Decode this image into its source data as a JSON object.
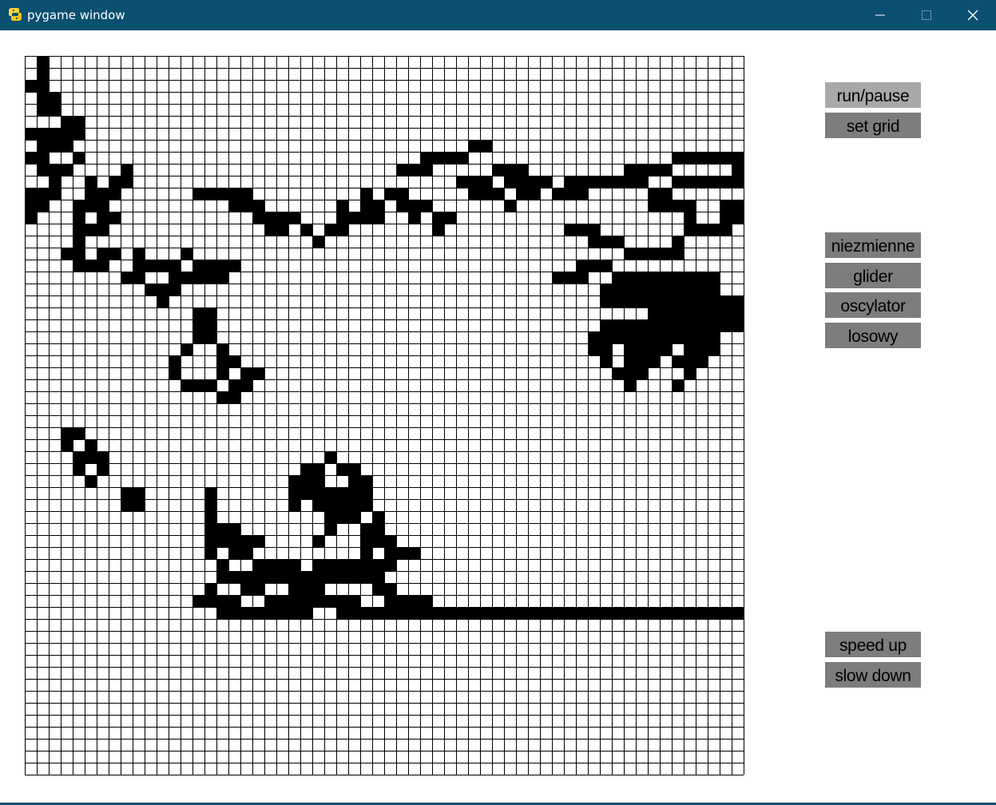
{
  "window": {
    "title": "pygame window",
    "app_icon": "python-snake-icon",
    "controls": [
      "minimize-icon",
      "maximize-icon",
      "close-icon"
    ],
    "title_bar_color": "#0b4f71"
  },
  "controls": {
    "run_pause": "run/pause",
    "set_grid": "set grid",
    "niezmienne": "niezmienne",
    "glider": "glider",
    "oscylator": "oscylator",
    "losowy": "losowy",
    "speed_up": "speed up",
    "slow_down": "slow down"
  },
  "grid": {
    "columns": 60,
    "rows": 60,
    "alive_color": "#000000",
    "dead_color": "#ffffff",
    "line_color": "#000000",
    "alive": [
      [
        1,
        0
      ],
      [
        1,
        1
      ],
      [
        1,
        2
      ],
      [
        0,
        2
      ],
      [
        1,
        3
      ],
      [
        1,
        4
      ],
      [
        2,
        3
      ],
      [
        2,
        4
      ],
      [
        4,
        5
      ],
      [
        3,
        5
      ],
      [
        3,
        6
      ],
      [
        3,
        7
      ],
      [
        2,
        6
      ],
      [
        2,
        7
      ],
      [
        0,
        6
      ],
      [
        1,
        6
      ],
      [
        4,
        6
      ],
      [
        0,
        8
      ],
      [
        4,
        8
      ],
      [
        1,
        9
      ],
      [
        2,
        9
      ],
      [
        3,
        9
      ],
      [
        1,
        7
      ],
      [
        1,
        8
      ],
      [
        0,
        11
      ],
      [
        0,
        12
      ],
      [
        1,
        11
      ],
      [
        1,
        12
      ],
      [
        2,
        10
      ],
      [
        2,
        11
      ],
      [
        0,
        13
      ],
      [
        4,
        12
      ],
      [
        5,
        12
      ],
      [
        6,
        12
      ],
      [
        6,
        13
      ],
      [
        7,
        13
      ],
      [
        6,
        14
      ],
      [
        5,
        11
      ],
      [
        6,
        11
      ],
      [
        7,
        10
      ],
      [
        8,
        9
      ],
      [
        8,
        10
      ],
      [
        7,
        11
      ],
      [
        5,
        10
      ],
      [
        5,
        14
      ],
      [
        4,
        13
      ],
      [
        4,
        14
      ],
      [
        4,
        15
      ],
      [
        3,
        16
      ],
      [
        4,
        16
      ],
      [
        4,
        17
      ],
      [
        5,
        17
      ],
      [
        6,
        17
      ],
      [
        6,
        16
      ],
      [
        7,
        16
      ],
      [
        9,
        16
      ],
      [
        9,
        17
      ],
      [
        10,
        17
      ],
      [
        11,
        17
      ],
      [
        12,
        17
      ],
      [
        9,
        18
      ],
      [
        8,
        18
      ],
      [
        10,
        19
      ],
      [
        11,
        19
      ],
      [
        11,
        20
      ],
      [
        12,
        19
      ],
      [
        12,
        18
      ],
      [
        14,
        17
      ],
      [
        15,
        17
      ],
      [
        16,
        17
      ],
      [
        16,
        18
      ],
      [
        15,
        18
      ],
      [
        14,
        18
      ],
      [
        13,
        18
      ],
      [
        13,
        16
      ],
      [
        17,
        17
      ],
      [
        20,
        14
      ],
      [
        21,
        14
      ],
      [
        21,
        13
      ],
      [
        20,
        13
      ],
      [
        19,
        13
      ],
      [
        19,
        12
      ],
      [
        18,
        12
      ],
      [
        17,
        12
      ],
      [
        17,
        11
      ],
      [
        16,
        11
      ],
      [
        15,
        11
      ],
      [
        14,
        11
      ],
      [
        18,
        11
      ],
      [
        22,
        13
      ],
      [
        23,
        14
      ],
      [
        24,
        15
      ],
      [
        25,
        14
      ],
      [
        26,
        14
      ],
      [
        26,
        13
      ],
      [
        26,
        12
      ],
      [
        27,
        13
      ],
      [
        28,
        12
      ],
      [
        29,
        12
      ],
      [
        28,
        13
      ],
      [
        29,
        13
      ],
      [
        28,
        11
      ],
      [
        30,
        11
      ],
      [
        31,
        11
      ],
      [
        31,
        12
      ],
      [
        32,
        12
      ],
      [
        32,
        13
      ],
      [
        33,
        12
      ],
      [
        34,
        13
      ],
      [
        34,
        14
      ],
      [
        35,
        13
      ],
      [
        31,
        9
      ],
      [
        32,
        9
      ],
      [
        33,
        8
      ],
      [
        33,
        9
      ],
      [
        34,
        8
      ],
      [
        35,
        8
      ],
      [
        36,
        8
      ],
      [
        37,
        7
      ],
      [
        38,
        7
      ],
      [
        36,
        10
      ],
      [
        37,
        10
      ],
      [
        38,
        10
      ],
      [
        37,
        11
      ],
      [
        38,
        11
      ],
      [
        39,
        11
      ],
      [
        40,
        12
      ],
      [
        41,
        11
      ],
      [
        42,
        11
      ],
      [
        41,
        10
      ],
      [
        40,
        10
      ],
      [
        39,
        9
      ],
      [
        40,
        9
      ],
      [
        41,
        9
      ],
      [
        42,
        10
      ],
      [
        43,
        10
      ],
      [
        44,
        11
      ],
      [
        45,
        11
      ],
      [
        46,
        11
      ],
      [
        47,
        10
      ],
      [
        46,
        10
      ],
      [
        45,
        10
      ],
      [
        48,
        10
      ],
      [
        49,
        10
      ],
      [
        50,
        10
      ],
      [
        51,
        10
      ],
      [
        50,
        9
      ],
      [
        51,
        9
      ],
      [
        52,
        9
      ],
      [
        53,
        9
      ],
      [
        54,
        8
      ],
      [
        55,
        8
      ],
      [
        56,
        8
      ],
      [
        57,
        8
      ],
      [
        58,
        8
      ],
      [
        59,
        8
      ],
      [
        59,
        9
      ],
      [
        59,
        10
      ],
      [
        58,
        10
      ],
      [
        57,
        10
      ],
      [
        56,
        10
      ],
      [
        55,
        10
      ],
      [
        54,
        10
      ],
      [
        53,
        11
      ],
      [
        52,
        11
      ],
      [
        52,
        12
      ],
      [
        53,
        12
      ],
      [
        54,
        12
      ],
      [
        55,
        12
      ],
      [
        55,
        13
      ],
      [
        55,
        14
      ],
      [
        56,
        14
      ],
      [
        57,
        14
      ],
      [
        58,
        14
      ],
      [
        58,
        13
      ],
      [
        59,
        13
      ],
      [
        59,
        12
      ],
      [
        58,
        12
      ],
      [
        45,
        14
      ],
      [
        46,
        14
      ],
      [
        47,
        14
      ],
      [
        47,
        15
      ],
      [
        48,
        15
      ],
      [
        49,
        15
      ],
      [
        50,
        16
      ],
      [
        51,
        16
      ],
      [
        52,
        16
      ],
      [
        53,
        16
      ],
      [
        54,
        15
      ],
      [
        54,
        16
      ],
      [
        44,
        18
      ],
      [
        45,
        18
      ],
      [
        46,
        18
      ],
      [
        46,
        17
      ],
      [
        47,
        17
      ],
      [
        48,
        17
      ],
      [
        49,
        18
      ],
      [
        50,
        18
      ],
      [
        51,
        18
      ],
      [
        52,
        19
      ],
      [
        53,
        19
      ],
      [
        54,
        19
      ],
      [
        55,
        19
      ],
      [
        56,
        19
      ],
      [
        57,
        19
      ],
      [
        57,
        18
      ],
      [
        56,
        18
      ],
      [
        55,
        18
      ],
      [
        54,
        18
      ],
      [
        53,
        18
      ],
      [
        52,
        18
      ],
      [
        51,
        19
      ],
      [
        50,
        19
      ],
      [
        49,
        19
      ],
      [
        48,
        19
      ],
      [
        48,
        20
      ],
      [
        49,
        20
      ],
      [
        50,
        20
      ],
      [
        51,
        20
      ],
      [
        52,
        20
      ],
      [
        53,
        20
      ],
      [
        54,
        21
      ],
      [
        55,
        21
      ],
      [
        56,
        21
      ],
      [
        57,
        21
      ],
      [
        58,
        21
      ],
      [
        59,
        21
      ],
      [
        59,
        20
      ],
      [
        58,
        20
      ],
      [
        57,
        20
      ],
      [
        56,
        20
      ],
      [
        55,
        20
      ],
      [
        54,
        20
      ],
      [
        53,
        21
      ],
      [
        52,
        21
      ],
      [
        51,
        22
      ],
      [
        52,
        22
      ],
      [
        53,
        22
      ],
      [
        54,
        22
      ],
      [
        55,
        22
      ],
      [
        56,
        22
      ],
      [
        57,
        22
      ],
      [
        58,
        22
      ],
      [
        59,
        22
      ],
      [
        50,
        22
      ],
      [
        49,
        22
      ],
      [
        48,
        22
      ],
      [
        47,
        23
      ],
      [
        48,
        23
      ],
      [
        49,
        23
      ],
      [
        50,
        23
      ],
      [
        51,
        23
      ],
      [
        52,
        23
      ],
      [
        53,
        23
      ],
      [
        54,
        23
      ],
      [
        55,
        23
      ],
      [
        56,
        23
      ],
      [
        57,
        23
      ],
      [
        47,
        24
      ],
      [
        48,
        24
      ],
      [
        50,
        24
      ],
      [
        51,
        24
      ],
      [
        52,
        24
      ],
      [
        53,
        24
      ],
      [
        55,
        24
      ],
      [
        56,
        24
      ],
      [
        57,
        24
      ],
      [
        48,
        25
      ],
      [
        50,
        25
      ],
      [
        51,
        25
      ],
      [
        52,
        25
      ],
      [
        54,
        25
      ],
      [
        55,
        25
      ],
      [
        56,
        25
      ],
      [
        49,
        26
      ],
      [
        50,
        26
      ],
      [
        51,
        26
      ],
      [
        55,
        26
      ],
      [
        50,
        27
      ],
      [
        54,
        27
      ],
      [
        14,
        21
      ],
      [
        15,
        21
      ],
      [
        14,
        22
      ],
      [
        15,
        22
      ],
      [
        14,
        23
      ],
      [
        15,
        23
      ],
      [
        13,
        24
      ],
      [
        16,
        24
      ],
      [
        12,
        25
      ],
      [
        12,
        26
      ],
      [
        16,
        25
      ],
      [
        16,
        26
      ],
      [
        13,
        27
      ],
      [
        14,
        27
      ],
      [
        15,
        27
      ],
      [
        17,
        25
      ],
      [
        18,
        26
      ],
      [
        17,
        27
      ],
      [
        18,
        27
      ],
      [
        19,
        26
      ],
      [
        16,
        28
      ],
      [
        17,
        28
      ],
      [
        3,
        31
      ],
      [
        4,
        31
      ],
      [
        3,
        32
      ],
      [
        5,
        32
      ],
      [
        6,
        33
      ],
      [
        4,
        33
      ],
      [
        5,
        33
      ],
      [
        6,
        34
      ],
      [
        5,
        35
      ],
      [
        4,
        34
      ],
      [
        8,
        36
      ],
      [
        9,
        36
      ],
      [
        8,
        37
      ],
      [
        9,
        37
      ],
      [
        15,
        36
      ],
      [
        15,
        37
      ],
      [
        15,
        38
      ],
      [
        16,
        39
      ],
      [
        16,
        40
      ],
      [
        17,
        40
      ],
      [
        18,
        40
      ],
      [
        19,
        40
      ],
      [
        17,
        39
      ],
      [
        15,
        39
      ],
      [
        15,
        40
      ],
      [
        15,
        41
      ],
      [
        17,
        41
      ],
      [
        18,
        41
      ],
      [
        19,
        42
      ],
      [
        20,
        42
      ],
      [
        21,
        42
      ],
      [
        22,
        42
      ],
      [
        23,
        43
      ],
      [
        24,
        43
      ],
      [
        22,
        43
      ],
      [
        21,
        43
      ],
      [
        20,
        43
      ],
      [
        19,
        43
      ],
      [
        18,
        43
      ],
      [
        17,
        43
      ],
      [
        16,
        42
      ],
      [
        16,
        43
      ],
      [
        15,
        44
      ],
      [
        14,
        45
      ],
      [
        15,
        45
      ],
      [
        16,
        45
      ],
      [
        17,
        45
      ],
      [
        18,
        44
      ],
      [
        19,
        44
      ],
      [
        20,
        45
      ],
      [
        21,
        45
      ],
      [
        22,
        44
      ],
      [
        23,
        44
      ],
      [
        24,
        44
      ],
      [
        25,
        43
      ],
      [
        26,
        43
      ],
      [
        27,
        43
      ],
      [
        28,
        43
      ],
      [
        29,
        44
      ],
      [
        30,
        44
      ],
      [
        29,
        43
      ],
      [
        28,
        42
      ],
      [
        27,
        42
      ],
      [
        26,
        42
      ],
      [
        25,
        42
      ],
      [
        24,
        42
      ],
      [
        24,
        40
      ],
      [
        25,
        39
      ],
      [
        25,
        38
      ],
      [
        26,
        38
      ],
      [
        27,
        38
      ],
      [
        28,
        39
      ],
      [
        28,
        40
      ],
      [
        28,
        41
      ],
      [
        29,
        42
      ],
      [
        30,
        42
      ],
      [
        30,
        41
      ],
      [
        31,
        41
      ],
      [
        32,
        41
      ],
      [
        30,
        40
      ],
      [
        29,
        40
      ],
      [
        29,
        39
      ],
      [
        29,
        38
      ],
      [
        28,
        37
      ],
      [
        27,
        37
      ],
      [
        26,
        36
      ],
      [
        25,
        33
      ],
      [
        24,
        34
      ],
      [
        23,
        34
      ],
      [
        22,
        35
      ],
      [
        23,
        35
      ],
      [
        24,
        35
      ],
      [
        26,
        34
      ],
      [
        27,
        34
      ],
      [
        27,
        35
      ],
      [
        27,
        36
      ],
      [
        28,
        35
      ],
      [
        28,
        36
      ],
      [
        26,
        37
      ],
      [
        24,
        36
      ],
      [
        23,
        36
      ],
      [
        24,
        37
      ],
      [
        25,
        37
      ],
      [
        25,
        36
      ],
      [
        22,
        36
      ],
      [
        22,
        37
      ],
      [
        25,
        45
      ],
      [
        26,
        45
      ],
      [
        27,
        45
      ],
      [
        24,
        45
      ],
      [
        23,
        45
      ],
      [
        22,
        45
      ],
      [
        30,
        45
      ],
      [
        31,
        45
      ],
      [
        32,
        45
      ],
      [
        33,
        45
      ],
      [
        16,
        46
      ],
      [
        17,
        46
      ],
      [
        18,
        46
      ],
      [
        19,
        46
      ],
      [
        20,
        46
      ],
      [
        21,
        46
      ],
      [
        22,
        46
      ],
      [
        23,
        46
      ],
      [
        26,
        46
      ],
      [
        27,
        46
      ],
      [
        28,
        46
      ],
      [
        29,
        46
      ],
      [
        30,
        46
      ],
      [
        31,
        46
      ],
      [
        32,
        46
      ],
      [
        33,
        46
      ],
      [
        34,
        46
      ],
      [
        35,
        46
      ],
      [
        36,
        46
      ],
      [
        37,
        46
      ],
      [
        38,
        46
      ],
      [
        39,
        46
      ],
      [
        40,
        46
      ],
      [
        41,
        46
      ],
      [
        42,
        46
      ],
      [
        43,
        46
      ],
      [
        44,
        46
      ],
      [
        45,
        46
      ],
      [
        46,
        46
      ],
      [
        47,
        46
      ],
      [
        48,
        46
      ],
      [
        49,
        46
      ],
      [
        50,
        46
      ],
      [
        51,
        46
      ],
      [
        52,
        46
      ],
      [
        53,
        46
      ],
      [
        54,
        46
      ],
      [
        55,
        46
      ],
      [
        56,
        46
      ],
      [
        57,
        46
      ],
      [
        58,
        46
      ],
      [
        59,
        46
      ]
    ]
  }
}
